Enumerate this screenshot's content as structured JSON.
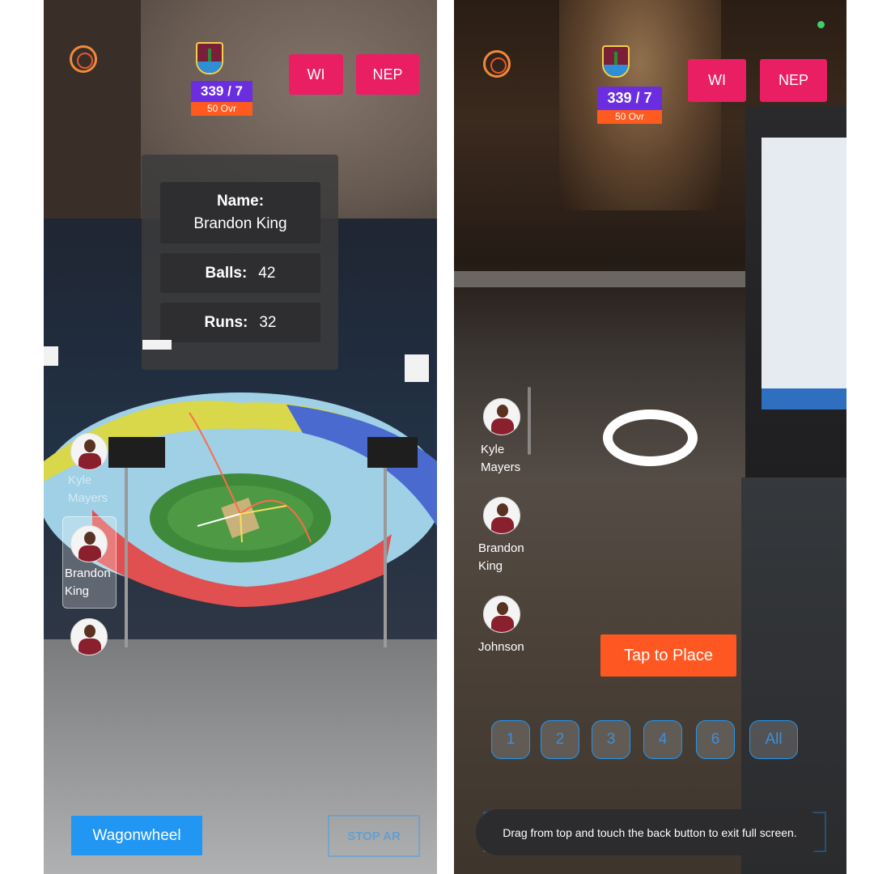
{
  "left_screen": {
    "score": "339 / 7",
    "overs": "50 Ovr",
    "teams": [
      "WI",
      "NEP"
    ],
    "info": {
      "name_label": "Name:",
      "name_value": "Brandon King",
      "balls_label": "Balls:",
      "balls_value": "42",
      "runs_label": "Runs:",
      "runs_value": "32"
    },
    "players": [
      {
        "first": "Kyle",
        "last": "Mayers"
      },
      {
        "first": "Brandon",
        "last": "King"
      },
      {
        "first": "",
        "last": ""
      }
    ],
    "wagonwheel_label": "Wagonwheel",
    "stop_ar_label": "STOP AR"
  },
  "right_screen": {
    "score": "339 / 7",
    "overs": "50 Ovr",
    "teams": [
      "WI",
      "NEP"
    ],
    "players": [
      {
        "first": "Kyle",
        "last": "Mayers"
      },
      {
        "first": "Brandon",
        "last": "King"
      },
      {
        "first": "Johnson",
        "last": ""
      }
    ],
    "tap_label": "Tap to Place",
    "filters": [
      "1",
      "2",
      "3",
      "4",
      "6",
      "All"
    ],
    "toast": "Drag from top and touch the back button to exit full screen."
  },
  "colors": {
    "team_button": "#e91e63",
    "score_bg": "#6a2ee0",
    "overs_bg": "#ff5a1f",
    "primary_blue": "#2196f3",
    "tap_orange": "#ff5722"
  },
  "icons": [
    "app-logo-icon",
    "west-indies-crest-icon",
    "player-avatar-icon",
    "placement-ring-icon"
  ]
}
